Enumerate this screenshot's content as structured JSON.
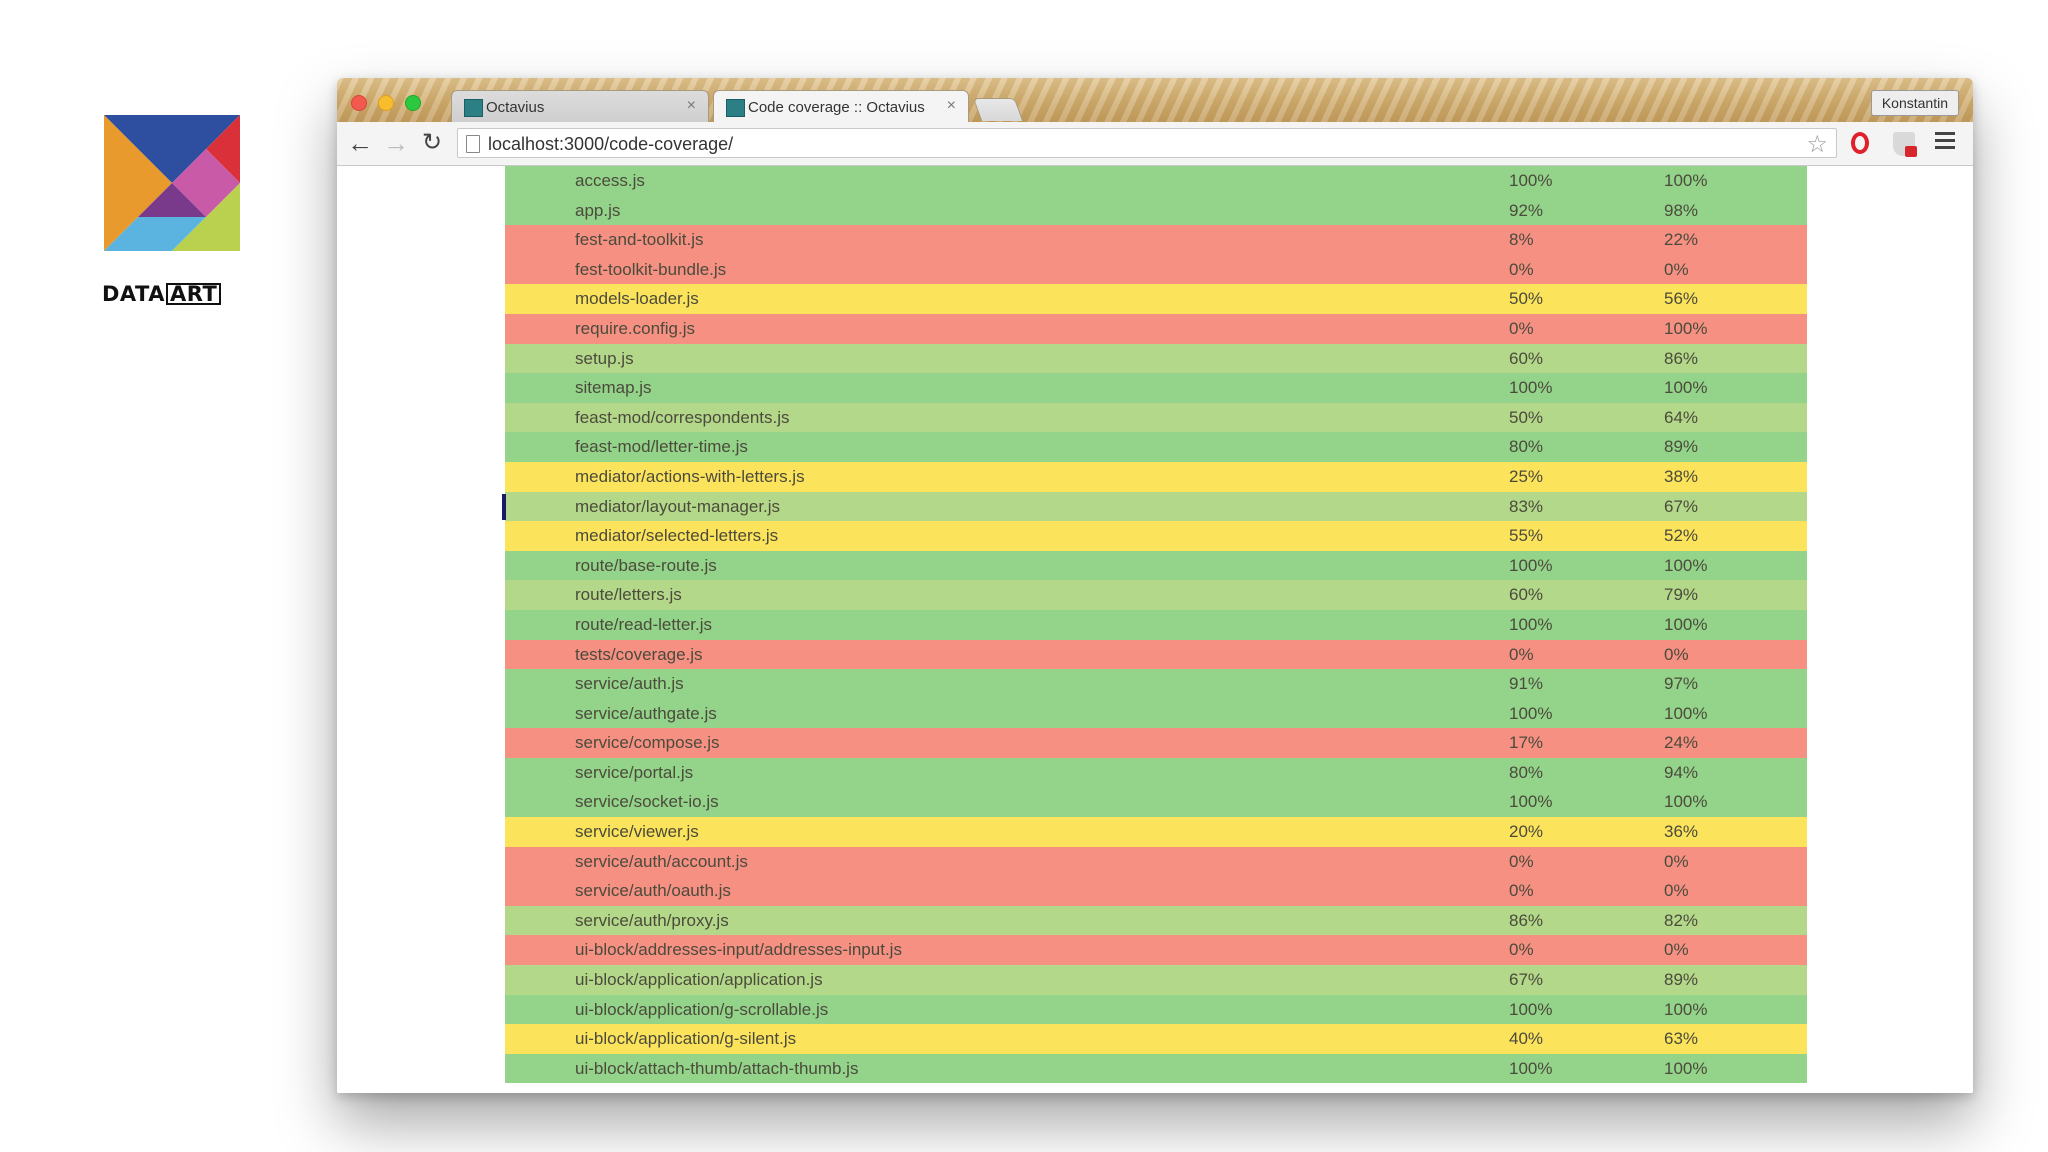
{
  "brand": {
    "logo_text_a": "DATA",
    "logo_text_b": "ART",
    "colors": {
      "blue": "#2e4fa0",
      "red": "#d9303a",
      "orange": "#e89a2c",
      "purple": "#7a3a8c",
      "pink": "#c85aa8",
      "sky": "#5bb3e0",
      "lime": "#b9d14f"
    }
  },
  "browser": {
    "tabs": [
      {
        "label": "Octavius",
        "close": "×"
      },
      {
        "label": "Code coverage :: Octavius",
        "close": "×"
      }
    ],
    "profile": "Konstantin",
    "url": "localhost:3000/code-coverage/"
  },
  "status_colors": {
    "full": "#94d38a",
    "good": "#b4d88a",
    "mid": "#fce35c",
    "bad": "#f59083"
  },
  "coverage": {
    "rows": [
      {
        "file": "access.js",
        "c1": "100%",
        "c2": "100%",
        "status": "full"
      },
      {
        "file": "app.js",
        "c1": "92%",
        "c2": "98%",
        "status": "full"
      },
      {
        "file": "fest-and-toolkit.js",
        "c1": "8%",
        "c2": "22%",
        "status": "bad"
      },
      {
        "file": "fest-toolkit-bundle.js",
        "c1": "0%",
        "c2": "0%",
        "status": "bad"
      },
      {
        "file": "models-loader.js",
        "c1": "50%",
        "c2": "56%",
        "status": "mid"
      },
      {
        "file": "require.config.js",
        "c1": "0%",
        "c2": "100%",
        "status": "bad"
      },
      {
        "file": "setup.js",
        "c1": "60%",
        "c2": "86%",
        "status": "good"
      },
      {
        "file": "sitemap.js",
        "c1": "100%",
        "c2": "100%",
        "status": "full"
      },
      {
        "file": "feast-mod/correspondents.js",
        "c1": "50%",
        "c2": "64%",
        "status": "good"
      },
      {
        "file": "feast-mod/letter-time.js",
        "c1": "80%",
        "c2": "89%",
        "status": "full"
      },
      {
        "file": "mediator/actions-with-letters.js",
        "c1": "25%",
        "c2": "38%",
        "status": "mid"
      },
      {
        "file": "mediator/layout-manager.js",
        "c1": "83%",
        "c2": "67%",
        "status": "good",
        "selected": true
      },
      {
        "file": "mediator/selected-letters.js",
        "c1": "55%",
        "c2": "52%",
        "status": "mid"
      },
      {
        "file": "route/base-route.js",
        "c1": "100%",
        "c2": "100%",
        "status": "full"
      },
      {
        "file": "route/letters.js",
        "c1": "60%",
        "c2": "79%",
        "status": "good"
      },
      {
        "file": "route/read-letter.js",
        "c1": "100%",
        "c2": "100%",
        "status": "full"
      },
      {
        "file": "tests/coverage.js",
        "c1": "0%",
        "c2": "0%",
        "status": "bad"
      },
      {
        "file": "service/auth.js",
        "c1": "91%",
        "c2": "97%",
        "status": "full"
      },
      {
        "file": "service/authgate.js",
        "c1": "100%",
        "c2": "100%",
        "status": "full"
      },
      {
        "file": "service/compose.js",
        "c1": "17%",
        "c2": "24%",
        "status": "bad"
      },
      {
        "file": "service/portal.js",
        "c1": "80%",
        "c2": "94%",
        "status": "full"
      },
      {
        "file": "service/socket-io.js",
        "c1": "100%",
        "c2": "100%",
        "status": "full"
      },
      {
        "file": "service/viewer.js",
        "c1": "20%",
        "c2": "36%",
        "status": "mid"
      },
      {
        "file": "service/auth/account.js",
        "c1": "0%",
        "c2": "0%",
        "status": "bad"
      },
      {
        "file": "service/auth/oauth.js",
        "c1": "0%",
        "c2": "0%",
        "status": "bad"
      },
      {
        "file": "service/auth/proxy.js",
        "c1": "86%",
        "c2": "82%",
        "status": "good"
      },
      {
        "file": "ui-block/addresses-input/addresses-input.js",
        "c1": "0%",
        "c2": "0%",
        "status": "bad"
      },
      {
        "file": "ui-block/application/application.js",
        "c1": "67%",
        "c2": "89%",
        "status": "good"
      },
      {
        "file": "ui-block/application/g-scrollable.js",
        "c1": "100%",
        "c2": "100%",
        "status": "full"
      },
      {
        "file": "ui-block/application/g-silent.js",
        "c1": "40%",
        "c2": "63%",
        "status": "mid"
      },
      {
        "file": "ui-block/attach-thumb/attach-thumb.js",
        "c1": "100%",
        "c2": "100%",
        "status": "full"
      }
    ]
  }
}
